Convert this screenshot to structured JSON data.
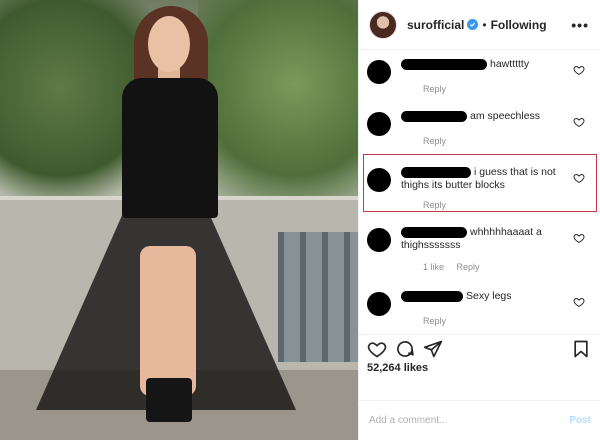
{
  "header": {
    "username": "surofficial",
    "separator": "•",
    "follow_label": "Following",
    "more_label": "•••"
  },
  "comments": [
    {
      "text": "hawttttty",
      "meta": [
        "Reply"
      ]
    },
    {
      "text": "am speechless",
      "meta": [
        "Reply"
      ]
    },
    {
      "text": "i guess that is not thighs its butter blocks",
      "meta": [
        "Reply"
      ],
      "highlighted": true
    },
    {
      "text": "whhhhhaaaat a thighsssssss",
      "meta": [
        "1 like",
        "Reply"
      ]
    },
    {
      "text": "Sexy legs",
      "meta": [
        "Reply"
      ]
    }
  ],
  "actions": {
    "icons": [
      "heart-icon",
      "comment-icon",
      "share-icon",
      "bookmark-icon"
    ]
  },
  "likes_label": "52,264 likes",
  "add_comment": {
    "placeholder": "Add a comment...",
    "post_label": "Post"
  },
  "colors": {
    "verified": "#3897f0",
    "highlight_border": "#c83746",
    "post_button": "#b3dbff",
    "meta_text": "#8e8e8e"
  }
}
